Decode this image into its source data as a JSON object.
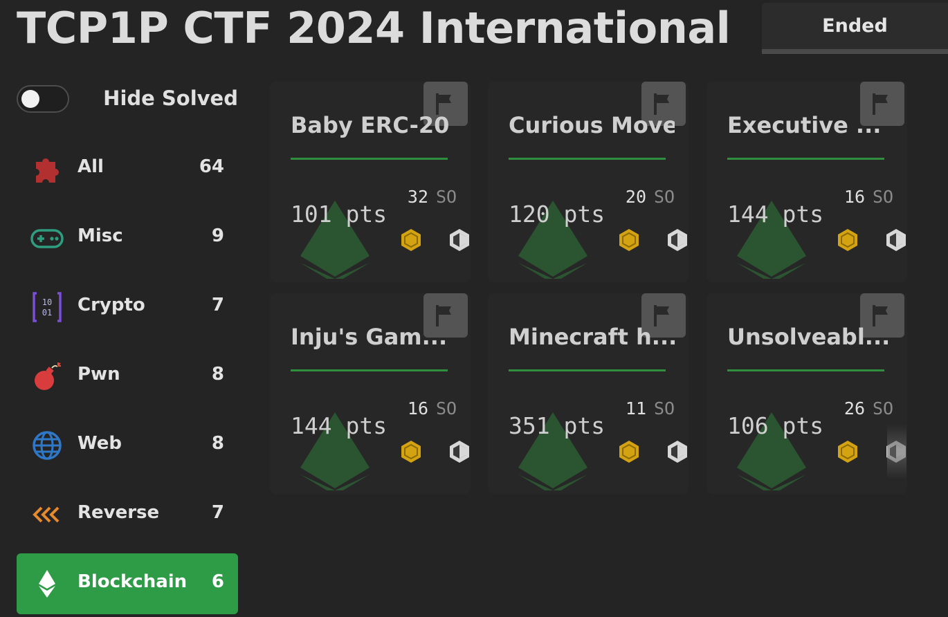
{
  "event": {
    "title": "TCP1P CTF 2024 International",
    "status": "Ended"
  },
  "filters": {
    "hide_solved_label": "Hide Solved",
    "hide_solved_on": false
  },
  "categories": [
    {
      "label": "All",
      "count": "64",
      "icon": "puzzle-icon",
      "color": "#b2302f"
    },
    {
      "label": "Misc",
      "count": "9",
      "icon": "gamepad-icon",
      "color": "#2f9d7f"
    },
    {
      "label": "Crypto",
      "count": "7",
      "icon": "binary-icon",
      "color": "#7a4fd6"
    },
    {
      "label": "Pwn",
      "count": "8",
      "icon": "bomb-icon",
      "color": "#d93c3c"
    },
    {
      "label": "Web",
      "count": "8",
      "icon": "globe-icon",
      "color": "#2f78c8"
    },
    {
      "label": "Reverse",
      "count": "7",
      "icon": "rewind-icon",
      "color": "#e58a2f"
    },
    {
      "label": "Blockchain",
      "count": "6",
      "icon": "ethereum-icon",
      "color": "#ffffff",
      "active": true
    }
  ],
  "challenges": [
    {
      "name": "Baby ERC-20",
      "points": "101 pts",
      "solves": "32",
      "solves_unit": "SO"
    },
    {
      "name": "Curious Move",
      "points": "120 pts",
      "solves": "20",
      "solves_unit": "SO"
    },
    {
      "name": "Executive ...",
      "points": "144 pts",
      "solves": "16",
      "solves_unit": "SO"
    },
    {
      "name": "Inju's Gam...",
      "points": "144 pts",
      "solves": "16",
      "solves_unit": "SO"
    },
    {
      "name": "Minecraft h...",
      "points": "351 pts",
      "solves": "11",
      "solves_unit": "SO"
    },
    {
      "name": "Unsolveabl...",
      "points": "106 pts",
      "solves": "26",
      "solves_unit": "SO"
    }
  ],
  "colors": {
    "accent_green": "#2e9b47",
    "rule_green": "#2f8f3e",
    "gold_badge": "#d4a312",
    "card_eth": "#2b5430"
  }
}
